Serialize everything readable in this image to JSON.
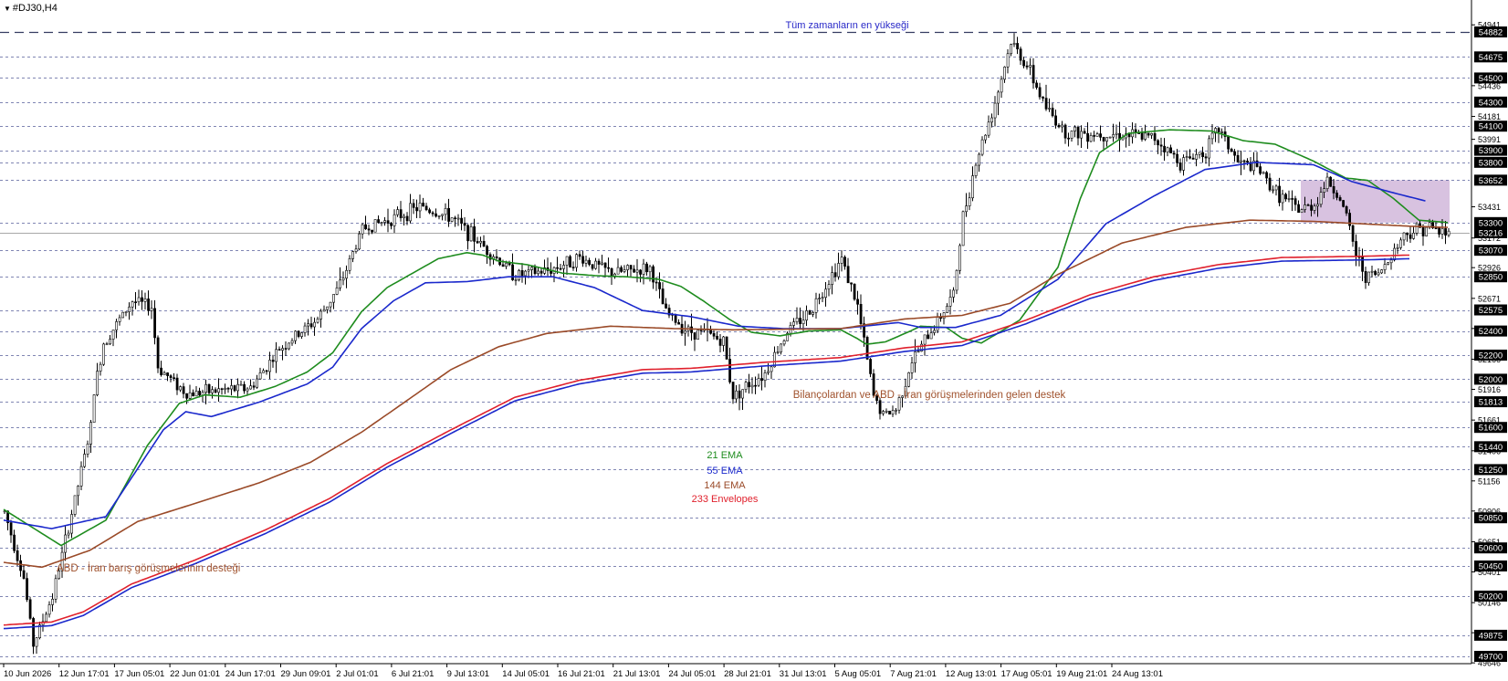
{
  "window": {
    "title": "#DJ30,H4",
    "menu_arrow": "▼"
  },
  "chart_data": {
    "type": "candlestick",
    "symbol": "#DJ30",
    "timeframe": "H4",
    "ylim": [
      49646,
      55000
    ],
    "x_tick_labels": [
      "10 Jun 2026",
      "12 Jun 17:01",
      "17 Jun 05:01",
      "22 Jun 01:01",
      "24 Jun 17:01",
      "29 Jun 09:01",
      "2 Jul 01:01",
      "6 Jul 21:01",
      "9 Jul 13:01",
      "14 Jul 05:01",
      "16 Jul 21:01",
      "21 Jul 13:01",
      "24 Jul 05:01",
      "28 Jul 21:01",
      "31 Jul 13:01",
      "5 Aug 05:01",
      "7 Aug 21:01",
      "12 Aug 13:01",
      "17 Aug 05:01",
      "19 Aug 21:01",
      "24 Aug 13:01"
    ],
    "y_tick_labels": [
      54941,
      54436,
      54181,
      53991,
      53431,
      53172,
      52926,
      52671,
      52421,
      52166,
      51916,
      51661,
      51406,
      51156,
      50906,
      50651,
      50401,
      50146,
      49896,
      49646
    ],
    "price_levels": [
      54882,
      54675,
      54500,
      54300,
      54100,
      53900,
      53800,
      53652,
      53300,
      53070,
      52850,
      52575,
      52400,
      52200,
      52000,
      51813,
      51600,
      51440,
      51250,
      50850,
      50600,
      50450,
      50200,
      49875,
      49700
    ],
    "current_price": 53216,
    "current_price_str": "53216",
    "resistance_zone": {
      "from": 53300,
      "to": 53652,
      "color": "#d8c2e0"
    },
    "series": [
      {
        "name": "21 EMA",
        "color": "#1e8c1e",
        "values": [
          [
            0,
            50920
          ],
          [
            18,
            50620
          ],
          [
            32,
            50830
          ],
          [
            45,
            51450
          ],
          [
            55,
            51800
          ],
          [
            63,
            51870
          ],
          [
            74,
            51850
          ],
          [
            85,
            51940
          ],
          [
            95,
            52060
          ],
          [
            103,
            52220
          ],
          [
            112,
            52560
          ],
          [
            120,
            52760
          ],
          [
            128,
            52880
          ],
          [
            136,
            53000
          ],
          [
            145,
            53050
          ],
          [
            150,
            53030
          ],
          [
            155,
            52980
          ],
          [
            164,
            52950
          ],
          [
            175,
            52880
          ],
          [
            185,
            52860
          ],
          [
            195,
            52850
          ],
          [
            205,
            52830
          ],
          [
            212,
            52770
          ],
          [
            219,
            52650
          ],
          [
            227,
            52500
          ],
          [
            234,
            52390
          ],
          [
            243,
            52360
          ],
          [
            252,
            52400
          ],
          [
            262,
            52410
          ],
          [
            267,
            52340
          ],
          [
            270,
            52290
          ],
          [
            276,
            52310
          ],
          [
            283,
            52390
          ],
          [
            287,
            52440
          ],
          [
            295,
            52430
          ],
          [
            300,
            52340
          ],
          [
            306,
            52300
          ],
          [
            318,
            52490
          ],
          [
            330,
            52930
          ],
          [
            337,
            53500
          ],
          [
            343,
            53880
          ],
          [
            352,
            54040
          ],
          [
            365,
            54070
          ],
          [
            378,
            54060
          ],
          [
            388,
            53980
          ],
          [
            398,
            53950
          ],
          [
            410,
            53810
          ],
          [
            420,
            53670
          ],
          [
            427,
            53650
          ],
          [
            435,
            53500
          ],
          [
            443,
            53320
          ],
          [
            452,
            53300
          ]
        ]
      },
      {
        "name": "55 EMA",
        "color": "#1a28cc",
        "values": [
          [
            0,
            50830
          ],
          [
            15,
            50760
          ],
          [
            32,
            50860
          ],
          [
            40,
            51180
          ],
          [
            50,
            51580
          ],
          [
            57,
            51730
          ],
          [
            65,
            51690
          ],
          [
            80,
            51810
          ],
          [
            95,
            51960
          ],
          [
            103,
            52100
          ],
          [
            112,
            52420
          ],
          [
            122,
            52650
          ],
          [
            132,
            52800
          ],
          [
            145,
            52810
          ],
          [
            158,
            52850
          ],
          [
            172,
            52850
          ],
          [
            185,
            52760
          ],
          [
            200,
            52570
          ],
          [
            215,
            52520
          ],
          [
            230,
            52440
          ],
          [
            244,
            52420
          ],
          [
            262,
            52420
          ],
          [
            280,
            52470
          ],
          [
            287,
            52430
          ],
          [
            298,
            52430
          ],
          [
            312,
            52530
          ],
          [
            330,
            52830
          ],
          [
            345,
            53290
          ],
          [
            360,
            53520
          ],
          [
            376,
            53740
          ],
          [
            392,
            53800
          ],
          [
            410,
            53780
          ],
          [
            422,
            53640
          ],
          [
            436,
            53540
          ],
          [
            445,
            53480
          ]
        ]
      },
      {
        "name": "144 EMA",
        "color": "#9a4a28",
        "values": [
          [
            0,
            50480
          ],
          [
            12,
            50440
          ],
          [
            27,
            50580
          ],
          [
            42,
            50820
          ],
          [
            60,
            50970
          ],
          [
            80,
            51140
          ],
          [
            96,
            51310
          ],
          [
            112,
            51560
          ],
          [
            125,
            51800
          ],
          [
            140,
            52080
          ],
          [
            155,
            52270
          ],
          [
            170,
            52380
          ],
          [
            190,
            52440
          ],
          [
            210,
            52420
          ],
          [
            228,
            52410
          ],
          [
            262,
            52420
          ],
          [
            282,
            52500
          ],
          [
            300,
            52530
          ],
          [
            315,
            52630
          ],
          [
            330,
            52870
          ],
          [
            350,
            53130
          ],
          [
            370,
            53260
          ],
          [
            390,
            53320
          ],
          [
            410,
            53310
          ],
          [
            425,
            53290
          ],
          [
            440,
            53270
          ],
          [
            452,
            53260
          ]
        ]
      },
      {
        "name": "233 Envelopes",
        "color": "#e0202c",
        "values": [
          [
            0,
            49960
          ],
          [
            15,
            49985
          ],
          [
            25,
            50070
          ],
          [
            40,
            50300
          ],
          [
            60,
            50500
          ],
          [
            82,
            50750
          ],
          [
            102,
            51010
          ],
          [
            120,
            51300
          ],
          [
            140,
            51580
          ],
          [
            160,
            51850
          ],
          [
            180,
            51990
          ],
          [
            200,
            52080
          ],
          [
            215,
            52090
          ],
          [
            238,
            52140
          ],
          [
            262,
            52180
          ],
          [
            282,
            52260
          ],
          [
            300,
            52310
          ],
          [
            320,
            52490
          ],
          [
            340,
            52700
          ],
          [
            360,
            52850
          ],
          [
            380,
            52950
          ],
          [
            400,
            53010
          ],
          [
            425,
            53020
          ],
          [
            440,
            53030
          ]
        ]
      },
      {
        "name": "233 Envelopes lower",
        "color": "#1a28cc",
        "values": [
          [
            0,
            49930
          ],
          [
            15,
            49955
          ],
          [
            25,
            50040
          ],
          [
            40,
            50270
          ],
          [
            60,
            50470
          ],
          [
            82,
            50720
          ],
          [
            102,
            50980
          ],
          [
            120,
            51270
          ],
          [
            140,
            51550
          ],
          [
            160,
            51820
          ],
          [
            180,
            51960
          ],
          [
            200,
            52050
          ],
          [
            215,
            52060
          ],
          [
            238,
            52110
          ],
          [
            262,
            52150
          ],
          [
            282,
            52230
          ],
          [
            300,
            52280
          ],
          [
            320,
            52460
          ],
          [
            340,
            52670
          ],
          [
            360,
            52820
          ],
          [
            380,
            52920
          ],
          [
            400,
            52980
          ],
          [
            425,
            52990
          ],
          [
            440,
            53000
          ]
        ]
      }
    ],
    "price_path": [
      [
        0,
        50900
      ],
      [
        6,
        50350
      ],
      [
        9,
        49800
      ],
      [
        15,
        50200
      ],
      [
        22,
        51000
      ],
      [
        27,
        51600
      ],
      [
        28,
        51900
      ],
      [
        31,
        52300
      ],
      [
        40,
        52650
      ],
      [
        46,
        52600
      ],
      [
        48,
        52100
      ],
      [
        57,
        51880
      ],
      [
        65,
        51900
      ],
      [
        77,
        51930
      ],
      [
        86,
        52250
      ],
      [
        98,
        52500
      ],
      [
        105,
        52780
      ],
      [
        112,
        53250
      ],
      [
        122,
        53340
      ],
      [
        130,
        53430
      ],
      [
        140,
        53340
      ],
      [
        150,
        53100
      ],
      [
        160,
        52860
      ],
      [
        170,
        52900
      ],
      [
        180,
        53010
      ],
      [
        190,
        52880
      ],
      [
        202,
        52920
      ],
      [
        207,
        52550
      ],
      [
        214,
        52400
      ],
      [
        220,
        52380
      ],
      [
        225,
        52310
      ],
      [
        228,
        51860
      ],
      [
        233,
        51960
      ],
      [
        238,
        52050
      ],
      [
        245,
        52400
      ],
      [
        252,
        52560
      ],
      [
        262,
        53000
      ],
      [
        267,
        52600
      ],
      [
        272,
        51860
      ],
      [
        275,
        51700
      ],
      [
        279,
        51750
      ],
      [
        284,
        52150
      ],
      [
        290,
        52400
      ],
      [
        297,
        52700
      ],
      [
        300,
        53350
      ],
      [
        304,
        53800
      ],
      [
        310,
        54300
      ],
      [
        315,
        54800
      ],
      [
        320,
        54600
      ],
      [
        326,
        54250
      ],
      [
        332,
        54050
      ],
      [
        350,
        54030
      ],
      [
        360,
        54000
      ],
      [
        368,
        53800
      ],
      [
        376,
        53900
      ],
      [
        380,
        54080
      ],
      [
        386,
        53800
      ],
      [
        392,
        53750
      ],
      [
        398,
        53550
      ],
      [
        405,
        53400
      ],
      [
        410,
        53450
      ],
      [
        414,
        53650
      ],
      [
        418,
        53500
      ],
      [
        421,
        53250
      ],
      [
        423,
        53030
      ],
      [
        426,
        52860
      ],
      [
        430,
        52870
      ],
      [
        438,
        53200
      ],
      [
        445,
        53270
      ],
      [
        452,
        53200
      ]
    ],
    "labels": {
      "all_time_high": "Tüm zamanların en yükseği",
      "support_earnings": "Bilançolardan ve ABD - İran görüşmelerinden gelen destek",
      "support_peace": "ABD - İran barış görüşmelerinin desteği",
      "ema21": "21 EMA",
      "ema55": "55 EMA",
      "ema144": "144 EMA",
      "envelopes233": "233 Envelopes"
    },
    "colors": {
      "candle": "#000000",
      "grid_dashed": "#1e2a7a",
      "all_time_high_line": "#202850",
      "label_blue": "#2828c8",
      "label_brown": "#a0522d",
      "tag_bg": "#000000",
      "tag_text": "#ffffff",
      "current_price_line": "#a8a8a8"
    }
  }
}
